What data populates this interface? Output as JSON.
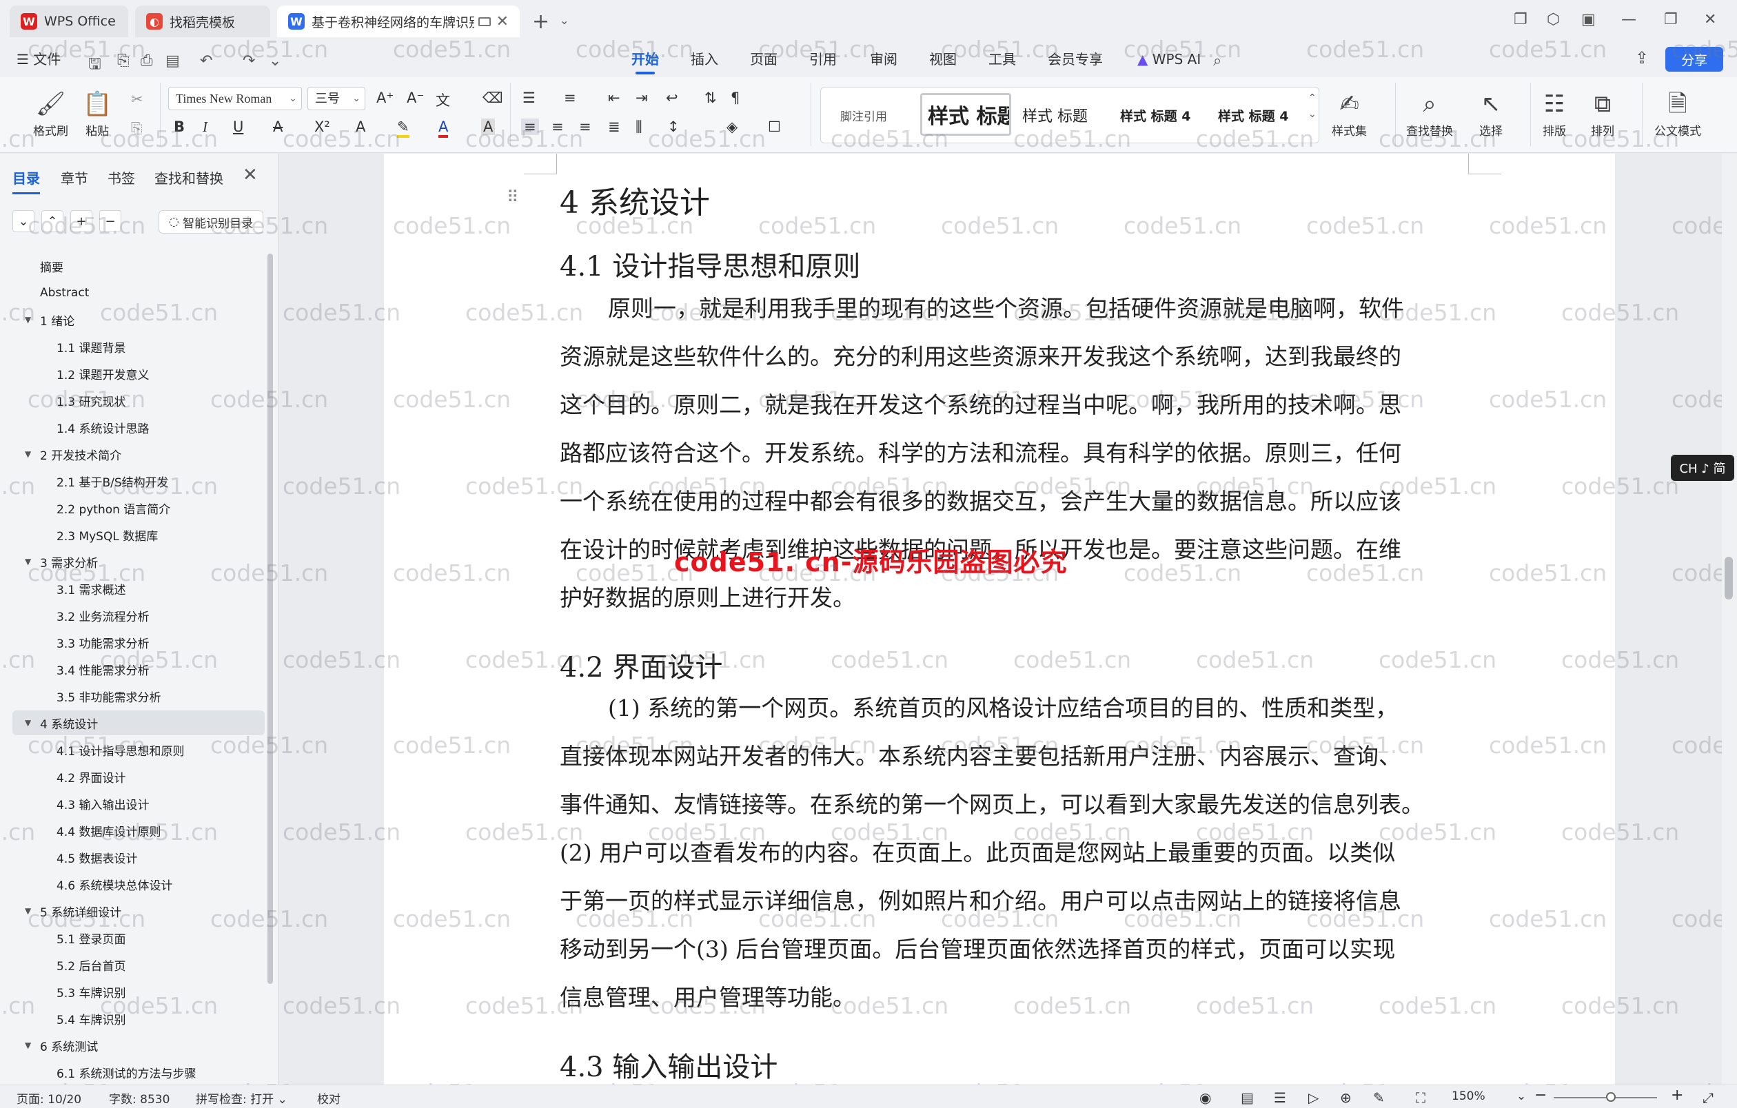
{
  "titlebar": {
    "tabs": [
      {
        "label": "WPS Office",
        "logo": "W"
      },
      {
        "label": "找稻壳模板",
        "logo": "◐"
      },
      {
        "label": "基于卷积神经网络的车牌识别",
        "logo": "W"
      }
    ]
  },
  "menu": {
    "file": "文件",
    "items": [
      "开始",
      "插入",
      "页面",
      "引用",
      "审阅",
      "视图",
      "工具",
      "会员专享",
      "WPS AI"
    ],
    "share": "分享"
  },
  "ribbon": {
    "format_painter": "格式刷",
    "paste": "粘贴",
    "font_name": "Times New Roman",
    "font_size": "三号",
    "styles": [
      "脚注引用",
      "样式 标题",
      "样式 标题",
      "样式 标题 4",
      "样式 标题 4"
    ],
    "style_set": "样式集",
    "find_replace": "查找替换",
    "select": "选择",
    "layout": "排版",
    "arrange": "排列",
    "official_mode": "公文模式"
  },
  "leftpanel": {
    "tabs": [
      "目录",
      "章节",
      "书签",
      "查找和替换"
    ],
    "smart_toc": "智能识别目录",
    "toc": [
      {
        "label": "摘要",
        "level": 0
      },
      {
        "label": "Abstract",
        "level": 0
      },
      {
        "label": "1   绪论",
        "level": 1,
        "expand": true
      },
      {
        "label": "1.1   课题背景",
        "level": 2
      },
      {
        "label": "1.2   课题开发意义",
        "level": 2
      },
      {
        "label": "1.3   研究现状",
        "level": 2
      },
      {
        "label": "1.4   系统设计思路",
        "level": 2
      },
      {
        "label": "2   开发技术简介",
        "level": 1,
        "expand": true
      },
      {
        "label": "2.1   基于B/S结构开发",
        "level": 2
      },
      {
        "label": "2.2   python 语言简介",
        "level": 2
      },
      {
        "label": "2.3   MySQL 数据库",
        "level": 2
      },
      {
        "label": "3   需求分析",
        "level": 1,
        "expand": true
      },
      {
        "label": "3.1   需求概述",
        "level": 2
      },
      {
        "label": "3.2   业务流程分析",
        "level": 2
      },
      {
        "label": "3.3   功能需求分析",
        "level": 2
      },
      {
        "label": "3.4   性能需求分析",
        "level": 2
      },
      {
        "label": "3.5   非功能需求分析",
        "level": 2
      },
      {
        "label": "4   系统设计",
        "level": 1,
        "expand": true,
        "selected": true
      },
      {
        "label": "4.1   设计指导思想和原则",
        "level": 2
      },
      {
        "label": "4.2   界面设计",
        "level": 2
      },
      {
        "label": "4.3   输入输出设计",
        "level": 2
      },
      {
        "label": "4.4   数据库设计原则",
        "level": 2
      },
      {
        "label": "4.5 数据表设计",
        "level": 2
      },
      {
        "label": "4.6 系统模块总体设计",
        "level": 2
      },
      {
        "label": "5   系统详细设计",
        "level": 1,
        "expand": true
      },
      {
        "label": "5.1   登录页面",
        "level": 2
      },
      {
        "label": "5.2   后台首页",
        "level": 2
      },
      {
        "label": "5.3   车牌识别",
        "level": 2
      },
      {
        "label": "5.4   车牌识别",
        "level": 2
      },
      {
        "label": "6   系统测试",
        "level": 1,
        "expand": true
      },
      {
        "label": "6.1   系统测试的方法与步骤",
        "level": 2
      }
    ]
  },
  "document": {
    "h1": "4    系统设计",
    "h2_1": "4.1    设计指导思想和原则",
    "p1": [
      "原则一，就是利用我手里的现有的这些个资源。包括硬件资源就是电脑啊，软件",
      "资源就是这些软件什么的。充分的利用这些资源来开发我这个系统啊，达到我最终的",
      "这个目的。原则二，就是我在开发这个系统的过程当中呢。啊，我所用的技术啊。思",
      "路都应该符合这个。开发系统。科学的方法和流程。具有科学的依据。原则三，任何",
      "一个系统在使用的过程中都会有很多的数据交互，会产生大量的数据信息。所以应该",
      "在设计的时候就考虑到维护这些数据的问题，所以开发也是。要注意这些问题。在维",
      "护好数据的原则上进行开发。"
    ],
    "h2_2": "4.2    界面设计",
    "p2": [
      "(1)  系统的第一个网页。系统首页的风格设计应结合项目的目的、性质和类型，",
      "直接体现本网站开发者的伟大。本系统内容主要包括新用户注册、内容展示、查询、",
      "事件通知、友情链接等。在系统的第一个网页上，可以看到大家最先发送的信息列表。",
      "(2)  用户可以查看发布的内容。在页面上。此页面是您网站上最重要的页面。以类似",
      "于第一页的样式显示详细信息，例如照片和介绍。用户可以点击网站上的链接将信息",
      "移动到另一个(3)  后台管理页面。后台管理页面依然选择首页的样式，页面可以实现",
      "信息管理、用户管理等功能。"
    ],
    "h2_3": "4.3    输入输出设计",
    "red_watermark": "code51. cn-源码乐园盗图必究",
    "watermark_text": "code51.cn"
  },
  "ime": "CH ♪ 简",
  "status": {
    "page": "页面: 10/20",
    "words": "字数: 8530",
    "spell": "拼写检查: 打开",
    "proof": "校对",
    "zoom": "150%"
  },
  "colors": {
    "accent": "#1a62e0",
    "wps_red": "#e8141d"
  }
}
